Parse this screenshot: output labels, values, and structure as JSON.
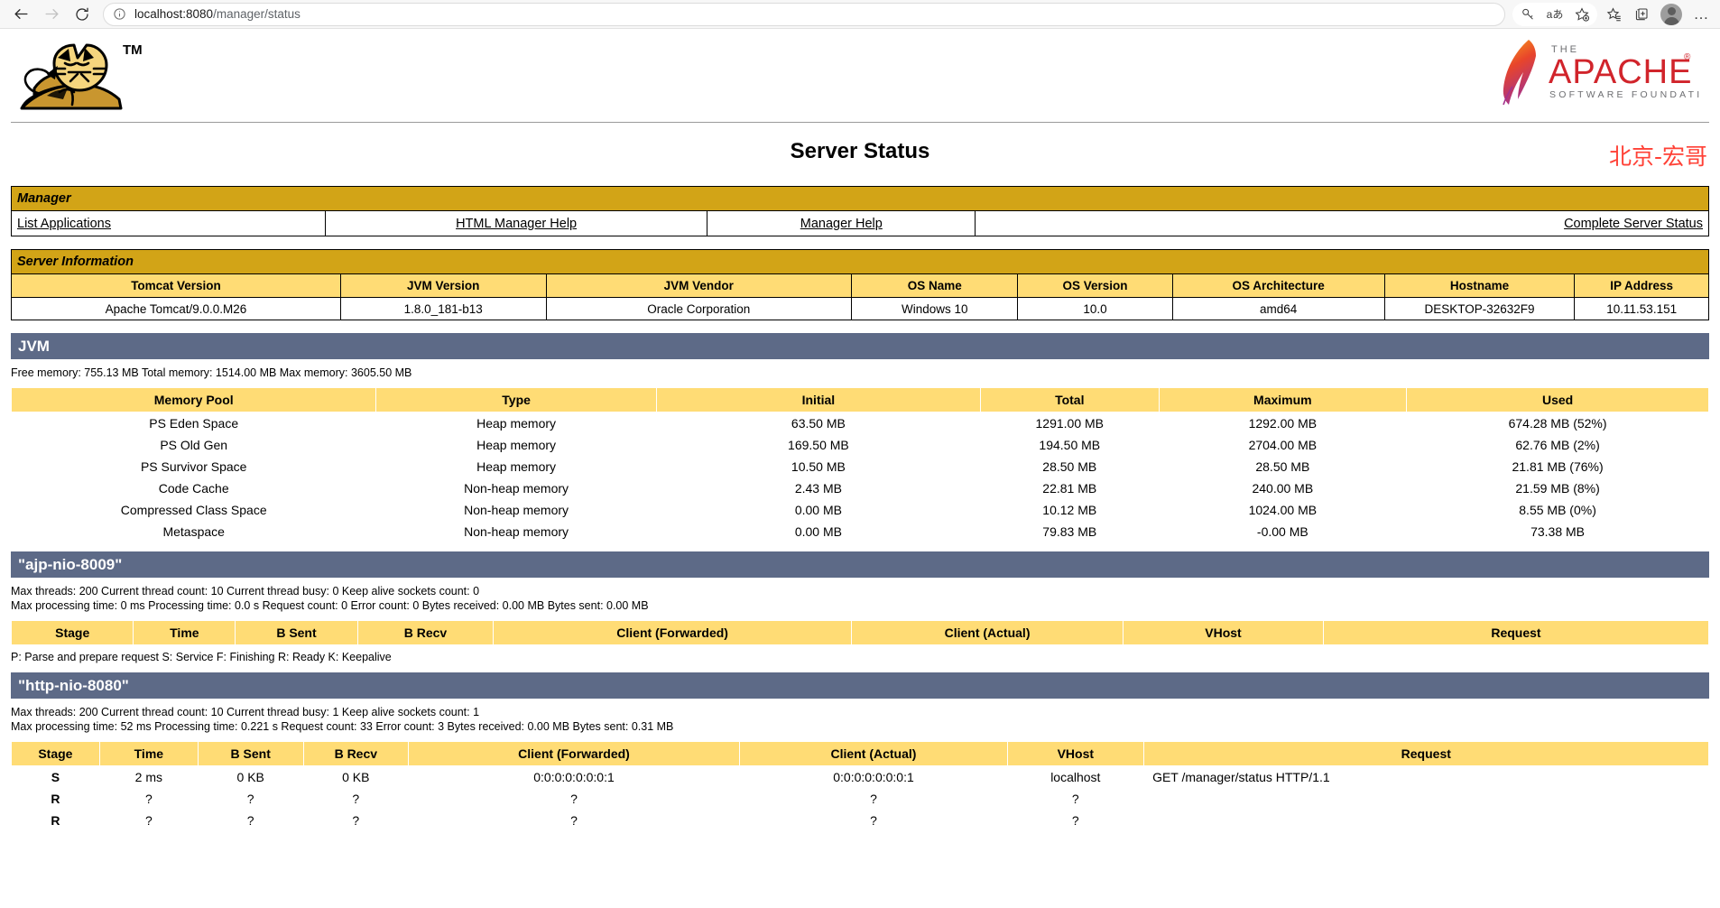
{
  "browser": {
    "url_host": "localhost:8080",
    "url_path": "/manager/status",
    "back_icon": "back-arrow-icon",
    "forward_icon": "forward-arrow-icon",
    "reload_icon": "reload-icon",
    "info_icon": "site-info-icon",
    "toolbar_icons": [
      "key-icon",
      "read-aloud-icon",
      "add-favorite-icon",
      "favorites-icon",
      "collections-icon",
      "profile-avatar-icon",
      "settings-more-icon"
    ],
    "read_aloud_label": "aあ",
    "more_label": "…"
  },
  "branding": {
    "tomcat_logo_alt": "tomcat-logo",
    "tomcat_tm": "TM",
    "apache_the": "THE",
    "apache_name": "APACHE",
    "apache_reg": "®",
    "apache_tagline": "SOFTWARE FOUNDATION"
  },
  "header": {
    "title": "Server Status",
    "watermark": "北京-宏哥",
    "watermark_color": "#ff4136"
  },
  "manager": {
    "band_title": "Manager",
    "links": [
      {
        "label": "List Applications",
        "align": "l"
      },
      {
        "label": "HTML Manager Help",
        "align": "c"
      },
      {
        "label": "Manager Help",
        "align": "c"
      },
      {
        "label": "Complete Server Status",
        "align": "r"
      }
    ]
  },
  "server_information": {
    "band_title": "Server Information",
    "columns": [
      "Tomcat Version",
      "JVM Version",
      "JVM Vendor",
      "OS Name",
      "OS Version",
      "OS Architecture",
      "Hostname",
      "IP Address"
    ],
    "row": [
      "Apache Tomcat/9.0.0.M26",
      "1.8.0_181-b13",
      "Oracle Corporation",
      "Windows 10",
      "10.0",
      "amd64",
      "DESKTOP-32632F9",
      "10.11.53.151"
    ]
  },
  "jvm": {
    "section_title": "JVM",
    "summary": "Free memory: 755.13 MB Total memory: 1514.00 MB Max memory: 3605.50 MB",
    "columns": [
      "Memory Pool",
      "Type",
      "Initial",
      "Total",
      "Maximum",
      "Used"
    ],
    "rows": [
      [
        "PS Eden Space",
        "Heap memory",
        "63.50 MB",
        "1291.00 MB",
        "1292.00 MB",
        "674.28 MB (52%)"
      ],
      [
        "PS Old Gen",
        "Heap memory",
        "169.50 MB",
        "194.50 MB",
        "2704.00 MB",
        "62.76 MB (2%)"
      ],
      [
        "PS Survivor Space",
        "Heap memory",
        "10.50 MB",
        "28.50 MB",
        "28.50 MB",
        "21.81 MB (76%)"
      ],
      [
        "Code Cache",
        "Non-heap memory",
        "2.43 MB",
        "22.81 MB",
        "240.00 MB",
        "21.59 MB (8%)"
      ],
      [
        "Compressed Class Space",
        "Non-heap memory",
        "0.00 MB",
        "10.12 MB",
        "1024.00 MB",
        "8.55 MB (0%)"
      ],
      [
        "Metaspace",
        "Non-heap memory",
        "0.00 MB",
        "79.83 MB",
        "-0.00 MB",
        "73.38 MB"
      ]
    ]
  },
  "connector_ajp": {
    "section_title": "\"ajp-nio-8009\"",
    "line1": "Max threads: 200 Current thread count: 10 Current thread busy: 0 Keep alive sockets count: 0",
    "line2": "Max processing time: 0 ms Processing time: 0.0 s Request count: 0 Error count: 0 Bytes received: 0.00 MB Bytes sent: 0.00 MB",
    "columns": [
      "Stage",
      "Time",
      "B Sent",
      "B Recv",
      "Client (Forwarded)",
      "Client (Actual)",
      "VHost",
      "Request"
    ],
    "rows": [],
    "legend": "P: Parse and prepare request S: Service F: Finishing R: Ready K: Keepalive"
  },
  "connector_http": {
    "section_title": "\"http-nio-8080\"",
    "line1": "Max threads: 200 Current thread count: 10 Current thread busy: 1 Keep alive sockets count: 1",
    "line2": "Max processing time: 52 ms Processing time: 0.221 s Request count: 33 Error count: 3 Bytes received: 0.00 MB Bytes sent: 0.31 MB",
    "columns": [
      "Stage",
      "Time",
      "B Sent",
      "B Recv",
      "Client (Forwarded)",
      "Client (Actual)",
      "VHost",
      "Request"
    ],
    "rows": [
      [
        "S",
        "2 ms",
        "0 KB",
        "0 KB",
        "0:0:0:0:0:0:0:1",
        "0:0:0:0:0:0:0:1",
        "localhost",
        "GET /manager/status HTTP/1.1"
      ],
      [
        "R",
        "?",
        "?",
        "?",
        "?",
        "?",
        "?",
        ""
      ],
      [
        "R",
        "?",
        "?",
        "?",
        "?",
        "?",
        "?",
        ""
      ]
    ]
  },
  "theme": {
    "band_gold": "#D2A417",
    "header_gold": "#FFDC75",
    "section_slate": "#5d6a87"
  }
}
